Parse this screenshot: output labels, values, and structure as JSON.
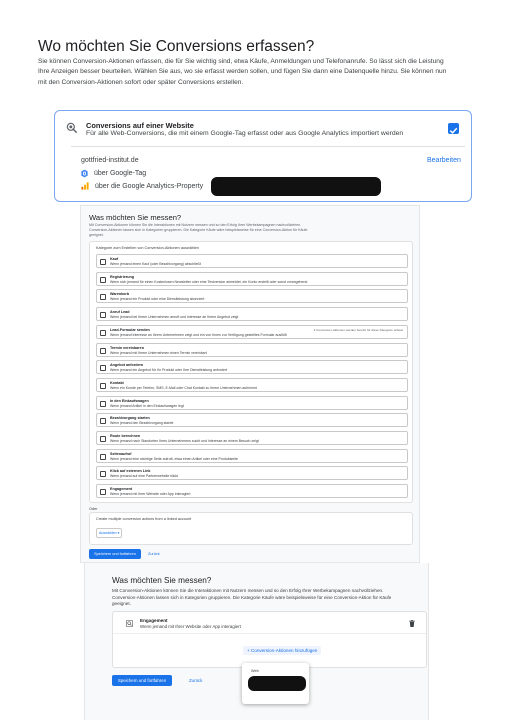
{
  "top": {
    "title": "Wo möchten Sie Conversions erfassen?",
    "desc_lines": [
      "Sie können Conversion-Aktionen erfassen, die für Sie wichtig sind, etwa Käufe, Anmeldungen und Telefonanrufe. So lässt sich die Leistung",
      "Ihre Anzeigen besser beurteilen. Wählen Sie aus, wo sie erfasst werden sollen, und fügen Sie dann eine Datenquelle hinzu. Sie können nun",
      "mit den Conversion-Aktionen sofort oder später Conversions erstellen."
    ],
    "card": {
      "title": "Conversions auf einer Website",
      "subtitle": "Für alle Web-Conversions, die mit einem Google-Tag erfasst oder aus Google Analytics importiert werden",
      "domain": "gottfried-institut.de",
      "edit_label": "Bearbeiten",
      "source_gtag": "über Google-Tag",
      "source_ga": "über die Google Analytics-Property",
      "checked": true
    }
  },
  "middle": {
    "title": "Was möchten Sie messen?",
    "desc_lines": [
      "Mit Conversion-Aktionen können Sie die Interaktionen mit Nutzern messen und so den Erfolg Ihrer Werbekampagnen nachvollziehen.",
      "Conversion-Aktionen lassen sich in Kategorien gruppieren. Die Kategorie Käufe wäre beispielsweise für eine Conversion-Aktion für Käufe",
      "geeignet."
    ],
    "category_heading": "Kategorie zum Erstellen von Conversion-Aktionen auswählen",
    "categories": [
      {
        "title": "Kauf",
        "desc": "Wenn jemand einen Kauf (oder Bezahlvorgang) abschließt",
        "note": ""
      },
      {
        "title": "Registrierung",
        "desc": "Wenn sich jemand für einen Kostenlosen Newsletter oder eine Testversion anmeldet, ein Konto erstellt oder sonst vorangehend",
        "note": ""
      },
      {
        "title": "Warenkorb",
        "desc": "Wenn jemand ein Produkt oder eine Dienstleistung abonniert",
        "note": ""
      },
      {
        "title": "Anruf Lead",
        "desc": "Wenn jemand bei Ihrem Unternehmen anruft und Interesse an Ihrem Angebot zeigt",
        "note": ""
      },
      {
        "title": "Lead-Formular senden",
        "desc": "Wenn jemand Interesse an Ihrem Unternehmen zeigt und ein von Ihnen zur Verfügung gestelltes Formular ausfüllt",
        "note": "2 Conversion-Aktionen werden bereits für diese Kategorie erfasst"
      },
      {
        "title": "Termin vereinbaren",
        "desc": "Wenn jemand mit Ihrem Unternehmen einen Termin vereinbart",
        "note": ""
      },
      {
        "title": "Angebot anfordern",
        "desc": "Wenn jemand ein Angebot für Ihr Produkt oder Ihre Dienstleistung anfordert",
        "note": ""
      },
      {
        "title": "Kontakt",
        "desc": "Wenn ein Kunde per Telefon, SMS, E-Mail oder Chat Kontakt zu Ihrem Unternehmen aufnimmt",
        "note": ""
      },
      {
        "title": "In den Einkaufswagen",
        "desc": "Wenn jemand Artikel in den Einkaufswagen legt",
        "note": ""
      },
      {
        "title": "Bezahlvorgang starten",
        "desc": "Wenn jemand den Bezahlvorgang startet",
        "note": ""
      },
      {
        "title": "Route berechnen",
        "desc": "Wenn jemand nach Standorten Ihres Unternehmens sucht und Interesse an einem Besuch zeigt",
        "note": ""
      },
      {
        "title": "Seitenaufruf",
        "desc": "Wenn jemand eine wichtige Seite aufruft, etwa einen Artikel oder eine Produktseite",
        "note": ""
      },
      {
        "title": "Klick auf externen Link",
        "desc": "Wenn jemand auf eine Partnerwebsite klickt",
        "note": ""
      },
      {
        "title": "Engagement",
        "desc": "Wenn jemand mit Ihrer Website oder App interagiert",
        "note": ""
      }
    ],
    "other_label": "Oder",
    "other_text": "Create multiple conversion actions from a linked account",
    "select_label": "Auswählen ▾",
    "save_label": "Speichern und fortfahren",
    "back_label": "Zurück"
  },
  "bottom": {
    "title": "Was möchten Sie messen?",
    "desc_lines": [
      "Mit Conversion-Aktionen können Sie die Interaktionen mit Nutzern messen und so den Erfolg Ihrer Werbekampagnen nachvollziehen.",
      "Conversion-Aktionen lassen sich in Kategorien gruppieren. Die Kategorie Käufe wäre beispielsweise für eine Conversion-Aktion für Käufe",
      "geeignet."
    ],
    "engagement_title": "Engagement",
    "engagement_desc": "Wenn jemand mit Ihrer Website oder App interagiert",
    "add_label": "+ Conversion-Aktionen hinzufügen",
    "save_label": "Speichern und fortfahren",
    "back_label": "Zurück",
    "dropdown_web": "Web"
  },
  "colors": {
    "accent": "#1a73e8",
    "card_border": "#7aa7f0",
    "analytics_orange": "#f9ab00"
  }
}
